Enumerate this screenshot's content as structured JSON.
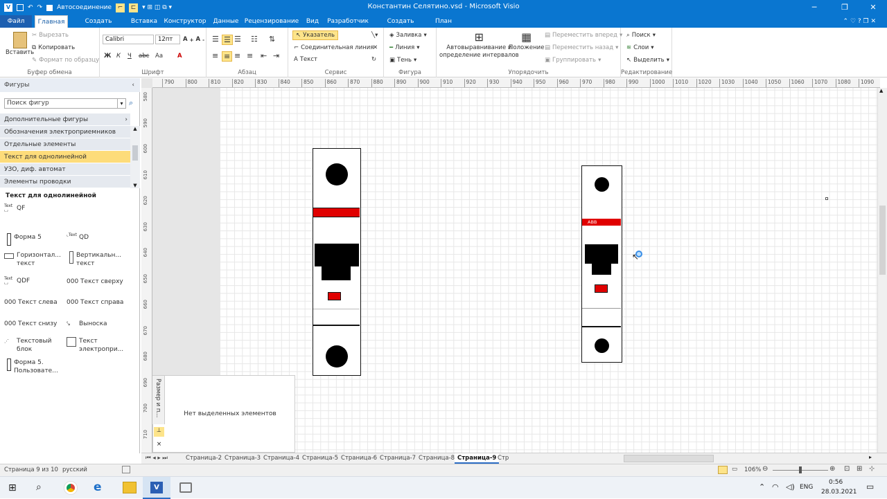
{
  "window": {
    "title": "Константин Селятино.vsd - Microsoft Visio",
    "qat_autoconnect": "Автосоединение"
  },
  "tabs": [
    "Файл",
    "Главная",
    "Создать вкладку",
    "Вставка",
    "Конструктор",
    "Данные",
    "Рецензирование",
    "Вид",
    "Разработчик",
    "Создать вкладку",
    "План"
  ],
  "ribbon": {
    "clipboard": {
      "label": "Буфер обмена",
      "paste": "Вставить",
      "cut": "Вырезать",
      "copy": "Копировать",
      "format_painter": "Формат по образцу"
    },
    "font": {
      "label": "Шрифт",
      "font_name": "Calibri",
      "font_size": "12пт",
      "bold": "Ж",
      "italic": "К",
      "underline": "Ч",
      "strike": "abc",
      "case": "Aa",
      "color": "A"
    },
    "paragraph": {
      "label": "Абзац"
    },
    "service": {
      "label": "Сервис",
      "pointer": "Указатель",
      "connector": "Соединительная линия",
      "text": "Текст"
    },
    "shape": {
      "label": "Фигура",
      "fill": "Заливка",
      "line": "Линия",
      "shadow": "Тень"
    },
    "arrange": {
      "label": "Упорядочить",
      "autoalign": "Автовыравнивание и",
      "autoalign2": "определение интервалов",
      "position": "Положение",
      "bring_forward": "Переместить вперед",
      "send_backward": "Переместить назад",
      "group": "Группировать"
    },
    "editing": {
      "label": "Редактирование",
      "find": "Поиск",
      "layers": "Слои",
      "select": "Выделить"
    }
  },
  "shapes_panel": {
    "title": "Фигуры",
    "search_placeholder": "Поиск фигур",
    "stencils": [
      "Дополнительные фигуры",
      "Обозначения электроприемников",
      "Отдельные элементы",
      "Текст для однолинейной",
      "УЗО, диф. автомат",
      "Элементы проводки"
    ],
    "selected_stencil_index": 3,
    "stencil_title": "Текст для однолинейной",
    "items": [
      {
        "name": "QF",
        "icon": "text-shape-icon"
      },
      {
        "name": "Форма 5",
        "icon": "breaker-mini-icon"
      },
      {
        "name": "QD",
        "icon": "text-shape-icon"
      },
      {
        "name": "Горизонтал... текст",
        "icon": "horizontal-text-icon"
      },
      {
        "name": "Вертикальн... текст",
        "icon": "vertical-text-icon"
      },
      {
        "name": "QDF",
        "icon": "text-shape-icon"
      },
      {
        "name": "000 Текст сверху",
        "icon": ""
      },
      {
        "name": "000 Текст слева",
        "icon": ""
      },
      {
        "name": "000 Текст справа",
        "icon": ""
      },
      {
        "name": "000 Текст снизу",
        "icon": ""
      },
      {
        "name": "Выноска",
        "icon": "callout-icon"
      },
      {
        "name": "Текстовый блок",
        "icon": "text-block-icon"
      },
      {
        "name": "Текст электропри...",
        "icon": "text-electro-icon"
      },
      {
        "name": "Форма 5. Пользовате...",
        "icon": "breaker-mini-icon"
      }
    ]
  },
  "ruler": {
    "h_ticks": [
      "790",
      "800",
      "810",
      "820",
      "830",
      "840",
      "850",
      "860",
      "870",
      "880",
      "890",
      "900",
      "910",
      "920",
      "930",
      "940",
      "950",
      "960",
      "970",
      "980",
      "990",
      "1000",
      "1010",
      "1020",
      "1030",
      "1040",
      "1050",
      "1060",
      "1070",
      "1080",
      "1090"
    ],
    "v_ticks": [
      "580",
      "590",
      "600",
      "610",
      "620",
      "630",
      "640",
      "650",
      "660",
      "670",
      "680",
      "690",
      "700",
      "710"
    ]
  },
  "canvas": {
    "breaker2_label": "ABB"
  },
  "size_panel": {
    "tab_label": "Размер и п...",
    "empty_text": "Нет выделенных элементов"
  },
  "page_tabs": [
    "Страница-2",
    "Страница-3",
    "Страница-4",
    "Страница-5",
    "Страница-6",
    "Страница-7",
    "Страница-8",
    "Страница-9",
    "Стр"
  ],
  "active_page_tab": 7,
  "status": {
    "page": "Страница 9 из 10",
    "language": "русский",
    "zoom": "106%"
  },
  "taskbar": {
    "lang": "ENG",
    "time": "0:56",
    "date": "28.03.2021"
  },
  "colors": {
    "accent": "#0a76d0",
    "breaker_red": "#e00000",
    "highlight": "#fde48a"
  }
}
